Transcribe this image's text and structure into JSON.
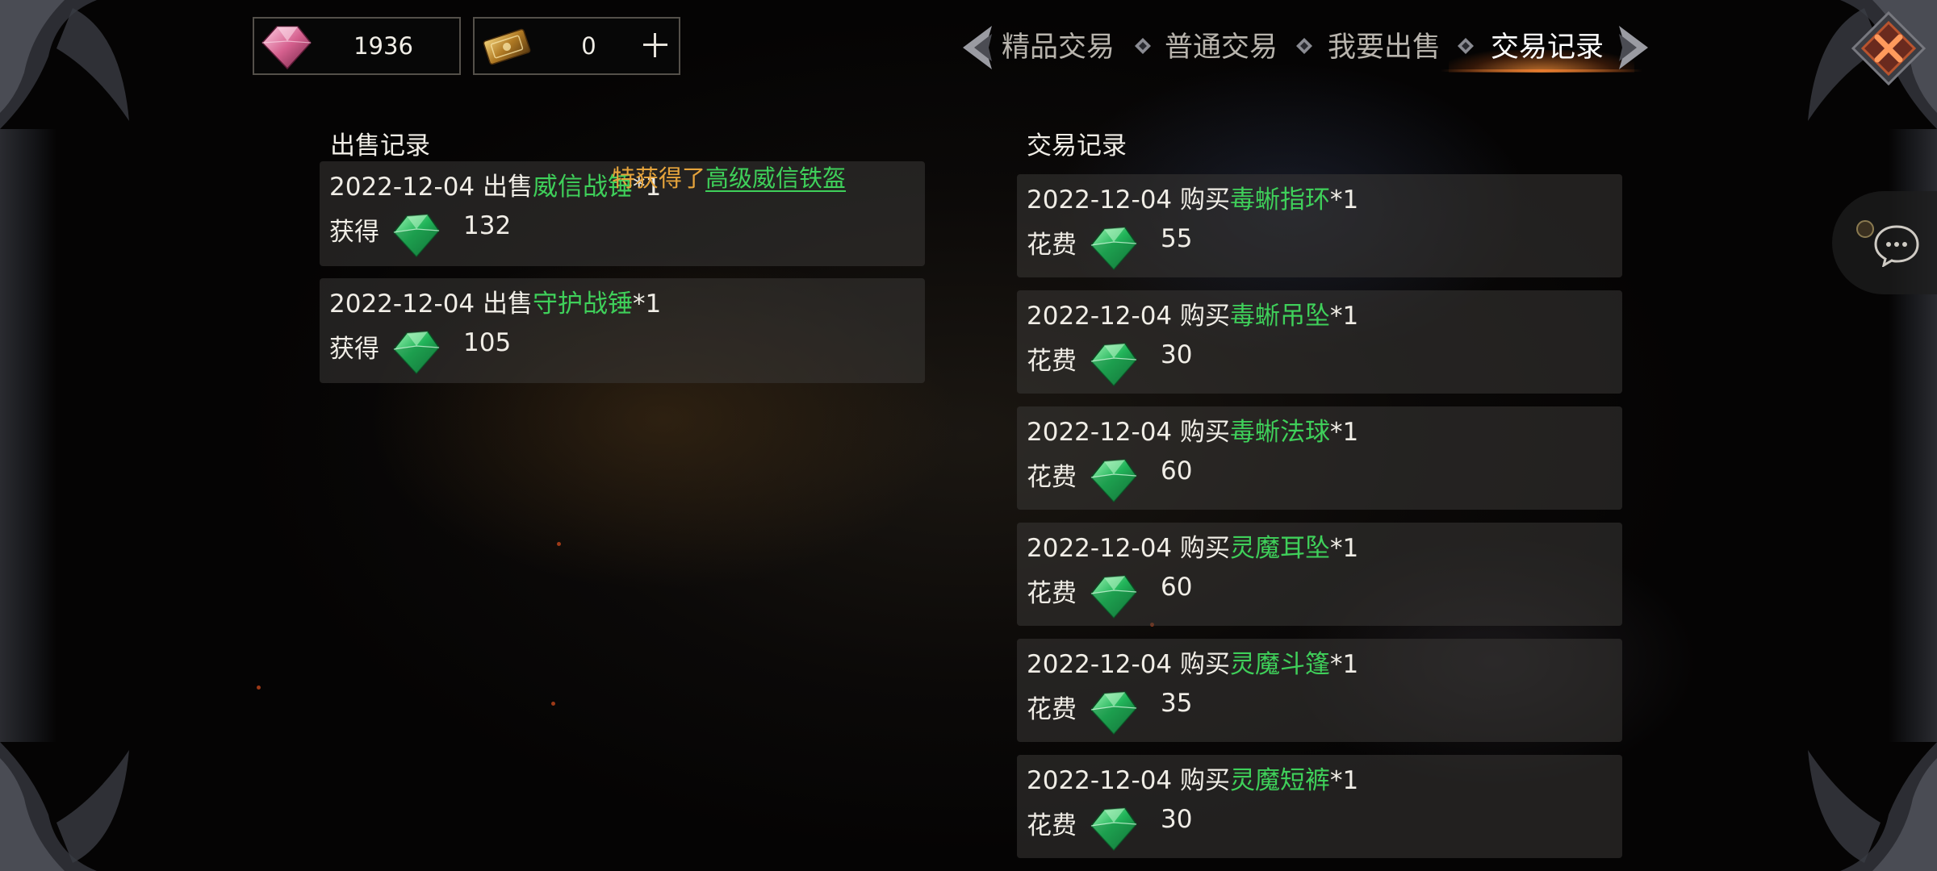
{
  "currency": {
    "gems": "1936",
    "tickets": "0"
  },
  "tabs": [
    {
      "label": "精品交易",
      "active": false
    },
    {
      "label": "普通交易",
      "active": false
    },
    {
      "label": "我要出售",
      "active": false
    },
    {
      "label": "交易记录",
      "active": true
    }
  ],
  "sales": {
    "title": "出售记录",
    "records": [
      {
        "date": "2022-12-04",
        "action": "出售",
        "item": "威信战锤",
        "qty": "*1",
        "label": "获得",
        "amount": "132"
      },
      {
        "date": "2022-12-04",
        "action": "出售",
        "item": "守护战锤",
        "qty": "*1",
        "label": "获得",
        "amount": "105"
      }
    ]
  },
  "trades": {
    "title": "交易记录",
    "records": [
      {
        "date": "2022-12-04",
        "action": "购买",
        "item": "毒蜥指环",
        "qty": "*1",
        "label": "花费",
        "amount": "55"
      },
      {
        "date": "2022-12-04",
        "action": "购买",
        "item": "毒蜥吊坠",
        "qty": "*1",
        "label": "花费",
        "amount": "30"
      },
      {
        "date": "2022-12-04",
        "action": "购买",
        "item": "毒蜥法球",
        "qty": "*1",
        "label": "花费",
        "amount": "60"
      },
      {
        "date": "2022-12-04",
        "action": "购买",
        "item": "灵魔耳坠",
        "qty": "*1",
        "label": "花费",
        "amount": "60"
      },
      {
        "date": "2022-12-04",
        "action": "购买",
        "item": "灵魔斗篷",
        "qty": "*1",
        "label": "花费",
        "amount": "35"
      },
      {
        "date": "2022-12-04",
        "action": "购买",
        "item": "灵魔短裤",
        "qty": "*1",
        "label": "花费",
        "amount": "30"
      }
    ]
  },
  "toast": {
    "prefix": "特获得了",
    "item": "高级威信铁盔"
  },
  "icons": {
    "gem_currency": "pink-diamond-icon",
    "ticket_currency": "gold-ticket-icon",
    "price_currency": "green-diamond-icon",
    "add": "plus-icon",
    "close": "close-icon",
    "chat": "chat-icon"
  },
  "colors": {
    "item_name": "#3fd05a",
    "toast_text": "#e6a43c",
    "active_tab_glow": "#e87a2e"
  }
}
